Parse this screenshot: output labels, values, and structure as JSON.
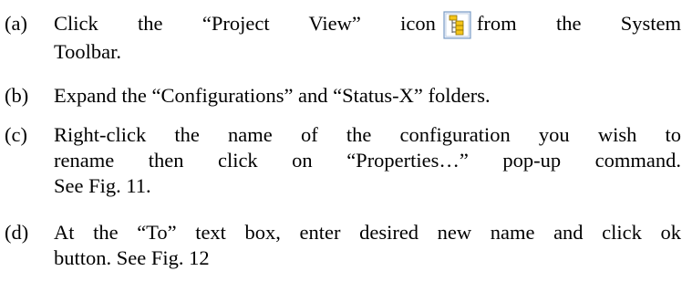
{
  "steps": [
    {
      "label": "(a)",
      "text_before_icon": "Click the “Project View” icon",
      "icon": "project-view-icon",
      "text_after_icon": "from the System",
      "line2": "Toolbar."
    },
    {
      "label": "(b)",
      "line1": "Expand the “Configurations” and “Status-X” folders."
    },
    {
      "label": "(c)",
      "line1": "Right-click the name of the configuration you wish to",
      "line2": "rename then click on “Properties…” pop-up command.",
      "line3": "See Fig. 11."
    },
    {
      "label": "(d)",
      "line1": "At the “To” text box, enter desired new name and click ok",
      "line2": "button.  See Fig. 12"
    }
  ],
  "colors": {
    "text": "#000000",
    "icon_border": "#7a9cc6",
    "icon_fill": "#ffffff",
    "folder_yellow": "#f5c518"
  }
}
